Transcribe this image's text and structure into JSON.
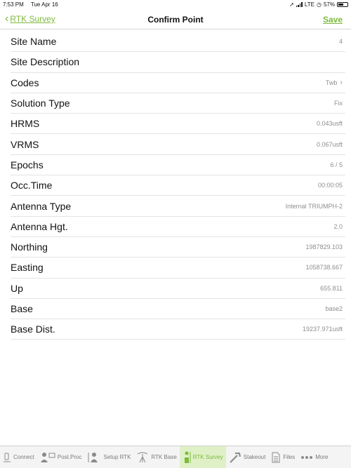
{
  "status_bar": {
    "time": "7:53 PM",
    "date": "Tue Apr 16",
    "network": "LTE",
    "battery": "57%",
    "battery_level": 0.57
  },
  "nav": {
    "back_label": "RTK Survey",
    "title": "Confirm Point",
    "save_label": "Save"
  },
  "fields": [
    {
      "label": "Site Name",
      "value": "4"
    },
    {
      "label": "Site Description",
      "value": ""
    },
    {
      "label": "Codes",
      "value": "Twb",
      "chevron": true
    },
    {
      "label": "Solution Type",
      "value": "Fix"
    },
    {
      "label": "HRMS",
      "value": "0.043usft"
    },
    {
      "label": "VRMS",
      "value": "0.067usft"
    },
    {
      "label": "Epochs",
      "value": "6 / 5"
    },
    {
      "label": "Occ.Time",
      "value": "00:00:05"
    },
    {
      "label": "Antenna Type",
      "value": "Internal TRIUMPH-2"
    },
    {
      "label": "Antenna Hgt.",
      "value": "2.0"
    },
    {
      "label": "Northing",
      "value": "1987829.103"
    },
    {
      "label": "Easting",
      "value": "1058738.667"
    },
    {
      "label": "Up",
      "value": "655.811"
    },
    {
      "label": "Base",
      "value": "base2"
    },
    {
      "label": "Base Dist.",
      "value": "19237.971usft"
    }
  ],
  "tabs": [
    {
      "label": "Connect",
      "icon": "connect-icon"
    },
    {
      "label": "Post.Proc",
      "icon": "post-proc-icon"
    },
    {
      "label": "Setup RTK",
      "icon": "setup-rtk-icon"
    },
    {
      "label": "RTK Base",
      "icon": "rtk-base-icon"
    },
    {
      "label": "RTK Survey",
      "icon": "rtk-survey-icon",
      "active": true
    },
    {
      "label": "Stakeout",
      "icon": "stakeout-icon"
    },
    {
      "label": "Files",
      "icon": "files-icon"
    },
    {
      "label": "More",
      "icon": "more-icon"
    }
  ],
  "colors": {
    "accent": "#7cba3c",
    "active_tab_bg": "#dff0c6"
  }
}
